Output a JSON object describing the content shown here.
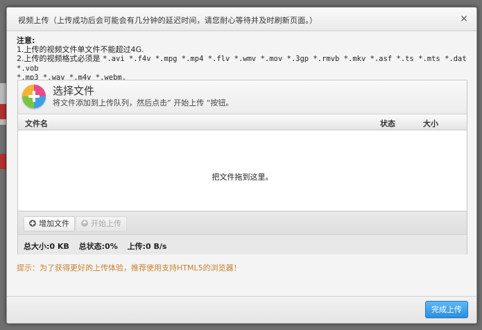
{
  "dialog": {
    "title": "视频上传（上传成功后会可能会有几分钟的延迟时间，请您耐心等待并及时刷新页面。）",
    "close_label": "×"
  },
  "notice": {
    "heading": "注意:",
    "line1": "1.上传的视频文件单文件不能超过4G.",
    "line2_prefix": "2.上传的视频格式必须是 ",
    "line2_formats": "*.avi *.f4v *.mpg *.mp4 *.flv *.wmv *.mov *.3gp *.rmvb *.mkv *.asf *.ts *.mts *.dat *.vob",
    "line3_formats": "*.mp3 *.wav *.m4v *.webm."
  },
  "picker": {
    "title": "选择文件",
    "subtitle": "将文件添加到上传队列，然后点击” 开始上传 “按钮。"
  },
  "table": {
    "columns": [
      "文件名",
      "状态",
      "大小"
    ]
  },
  "dropzone": {
    "text": "把文件拖到这里。"
  },
  "buttons": {
    "add": "增加文件",
    "start": "开始上传",
    "done": "完成上传"
  },
  "stats": {
    "total_size": "总大小:0 KB",
    "total_status": "总状态:0%",
    "upload_speed": "上传:0 B/s"
  },
  "tip": "提示：为了获得更好的上传体验，推荐使用支持HTML5的浏览器！",
  "colors": {
    "accent": "#2b8fdf",
    "tip_text": "#c8822c"
  }
}
